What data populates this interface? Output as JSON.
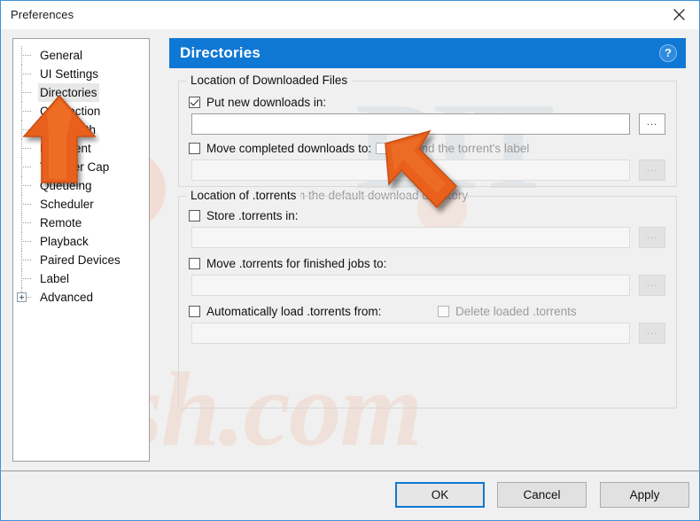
{
  "window": {
    "title": "Preferences",
    "close_icon": "close-icon"
  },
  "sidebar": {
    "items": [
      {
        "label": "General",
        "selected": false,
        "expandable": false
      },
      {
        "label": "UI Settings",
        "selected": false,
        "expandable": false
      },
      {
        "label": "Directories",
        "selected": true,
        "expandable": false
      },
      {
        "label": "Connection",
        "selected": false,
        "expandable": false
      },
      {
        "label": "Bandwidth",
        "selected": false,
        "expandable": false
      },
      {
        "label": "BitTorrent",
        "selected": false,
        "expandable": false
      },
      {
        "label": "Transfer Cap",
        "selected": false,
        "expandable": false
      },
      {
        "label": "Queueing",
        "selected": false,
        "expandable": false
      },
      {
        "label": "Scheduler",
        "selected": false,
        "expandable": false
      },
      {
        "label": "Remote",
        "selected": false,
        "expandable": false
      },
      {
        "label": "Playback",
        "selected": false,
        "expandable": false
      },
      {
        "label": "Paired Devices",
        "selected": false,
        "expandable": false
      },
      {
        "label": "Label",
        "selected": false,
        "expandable": false
      },
      {
        "label": "Advanced",
        "selected": false,
        "expandable": true
      }
    ]
  },
  "page": {
    "title": "Directories",
    "help_icon": "?",
    "header_color": "#0f78d4"
  },
  "groups": {
    "downloads": {
      "legend": "Location of Downloaded Files",
      "put_new_downloads": {
        "label": "Put new downloads in:",
        "checked": true,
        "value": "",
        "browse_label": "...",
        "enabled": true
      },
      "move_completed": {
        "label": "Move completed downloads to:",
        "checked": false,
        "value": "",
        "browse_label": "...",
        "enabled": false
      },
      "append_label": {
        "label": "Append the torrent's label",
        "checked": false,
        "enabled": false
      },
      "only_move_default": {
        "label": "Only move from the default download directory",
        "checked": true,
        "enabled": false
      }
    },
    "torrents": {
      "legend": "Location of .torrents",
      "store_torrents": {
        "label": "Store .torrents in:",
        "checked": false,
        "value": "",
        "browse_label": "...",
        "enabled": false
      },
      "move_finished": {
        "label": "Move .torrents for finished jobs to:",
        "checked": false,
        "value": "",
        "browse_label": "...",
        "enabled": false
      },
      "auto_load": {
        "label": "Automatically load .torrents from:",
        "checked": false,
        "value": "",
        "browse_label": "...",
        "enabled": false
      },
      "delete_loaded": {
        "label": "Delete loaded .torrents",
        "checked": false,
        "enabled": false
      }
    }
  },
  "buttons": {
    "ok": "OK",
    "cancel": "Cancel",
    "apply": "Apply"
  },
  "watermark": {
    "top": "BIT",
    "bottom": "rish.com",
    "color": "#ef8b55"
  }
}
